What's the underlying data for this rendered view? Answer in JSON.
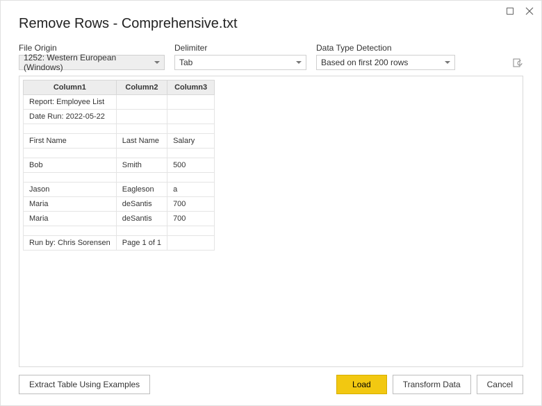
{
  "window": {
    "title": "Remove Rows - Comprehensive.txt"
  },
  "options": {
    "file_origin": {
      "label": "File Origin",
      "value": "1252: Western European (Windows)"
    },
    "delimiter": {
      "label": "Delimiter",
      "value": "Tab"
    },
    "detection": {
      "label": "Data Type Detection",
      "value": "Based on first 200 rows"
    }
  },
  "table": {
    "headers": [
      "Column1",
      "Column2",
      "Column3"
    ],
    "rows": [
      [
        "Report: Employee List",
        "",
        ""
      ],
      [
        "Date Run: 2022-05-22",
        "",
        ""
      ],
      [
        "",
        "",
        ""
      ],
      [
        "First Name",
        "Last Name",
        "Salary"
      ],
      [
        "",
        "",
        ""
      ],
      [
        "Bob",
        "Smith",
        "500"
      ],
      [
        "",
        "",
        ""
      ],
      [
        "Jason",
        "Eagleson",
        "a"
      ],
      [
        "Maria",
        "deSantis",
        "700"
      ],
      [
        "Maria",
        "deSantis",
        "700"
      ],
      [
        "",
        "",
        ""
      ],
      [
        "Run by: Chris Sorensen",
        "Page 1 of 1",
        ""
      ]
    ]
  },
  "footer": {
    "extract": "Extract Table Using Examples",
    "load": "Load",
    "transform": "Transform Data",
    "cancel": "Cancel"
  }
}
